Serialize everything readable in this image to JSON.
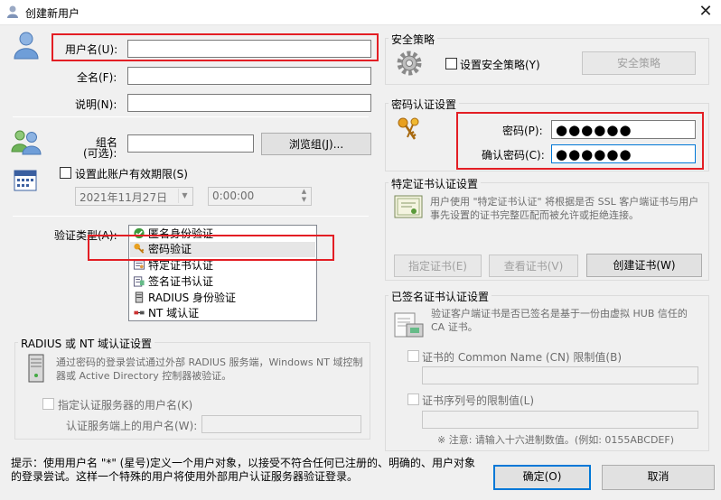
{
  "window": {
    "title": "创建新用户",
    "close_glyph": "✕"
  },
  "user": {
    "username_label": "用户名(U):",
    "username_value": "",
    "fullname_label": "全名(F):",
    "fullname_value": "",
    "description_label": "说明(N):",
    "description_value": "",
    "group_label_line1": "组名",
    "group_label_line2": "(可选):",
    "group_value": "",
    "browse_group_button": "浏览组(J)...",
    "expire_checkbox_label": "设置此账户有效期限(S)",
    "expire_date": "2021年11月27日",
    "expire_time": "0:00:00"
  },
  "auth": {
    "type_label": "验证类型(A):",
    "options": [
      "匿名身份验证",
      "密码验证",
      "特定证书认证",
      "签名证书认证",
      "RADIUS 身份验证",
      "NT 域认证"
    ],
    "selected": "密码验证"
  },
  "radius": {
    "group_title": "RADIUS 或 NT 域认证设置",
    "description": "通过密码的登录尝试通过外部 RADIUS 服务端，Windows NT 域控制器或 Active Directory 控制器被验证。",
    "specify_checkbox": "指定认证服务器的用户名(K)",
    "server_user_label": "认证服务端上的用户名(W):",
    "server_user_value": ""
  },
  "hint": {
    "line1": "提示：使用用户名 \"*\" (星号)定义一个用户对象，以接受不符合任何已注册的、明确的、用户对象",
    "line2": "的登录尝试。这样一个特殊的用户将使用外部用户认证服务器验证登录。"
  },
  "security": {
    "group_title": "安全策略",
    "checkbox_label": "设置安全策略(Y)",
    "button": "安全策略"
  },
  "password": {
    "group_title": "密码认证设置",
    "password_label": "密码(P):",
    "password_value": "●●●●●●",
    "confirm_label": "确认密码(C):",
    "confirm_value": "●●●●●●"
  },
  "specific_cert": {
    "group_title": "特定证书认证设置",
    "description": "用户使用 \"特定证书认证\" 将根据是否 SSL 客户端证书与用户事先设置的证书完整匹配而被允许或拒绝连接。",
    "specify_button": "指定证书(E)",
    "view_button": "查看证书(V)",
    "create_button": "创建证书(W)"
  },
  "signed_cert": {
    "group_title": "已签名证书认证设置",
    "description": "验证客户端证书是否已签名是基于一份由虚拟 HUB 信任的 CA 证书。",
    "cn_checkbox": "证书的 Common Name (CN) 限制值(B)",
    "cn_value": "",
    "serial_checkbox": "证书序列号的限制值(L)",
    "serial_value": "",
    "note": "※ 注意: 请输入十六进制数值。(例如: 0155ABCDEF)"
  },
  "footer": {
    "ok_button": "确定(O)",
    "cancel_button": "取消"
  },
  "colors": {
    "highlight": "#e31e24",
    "accent": "#0078d7",
    "selection": "#cce8ff"
  }
}
